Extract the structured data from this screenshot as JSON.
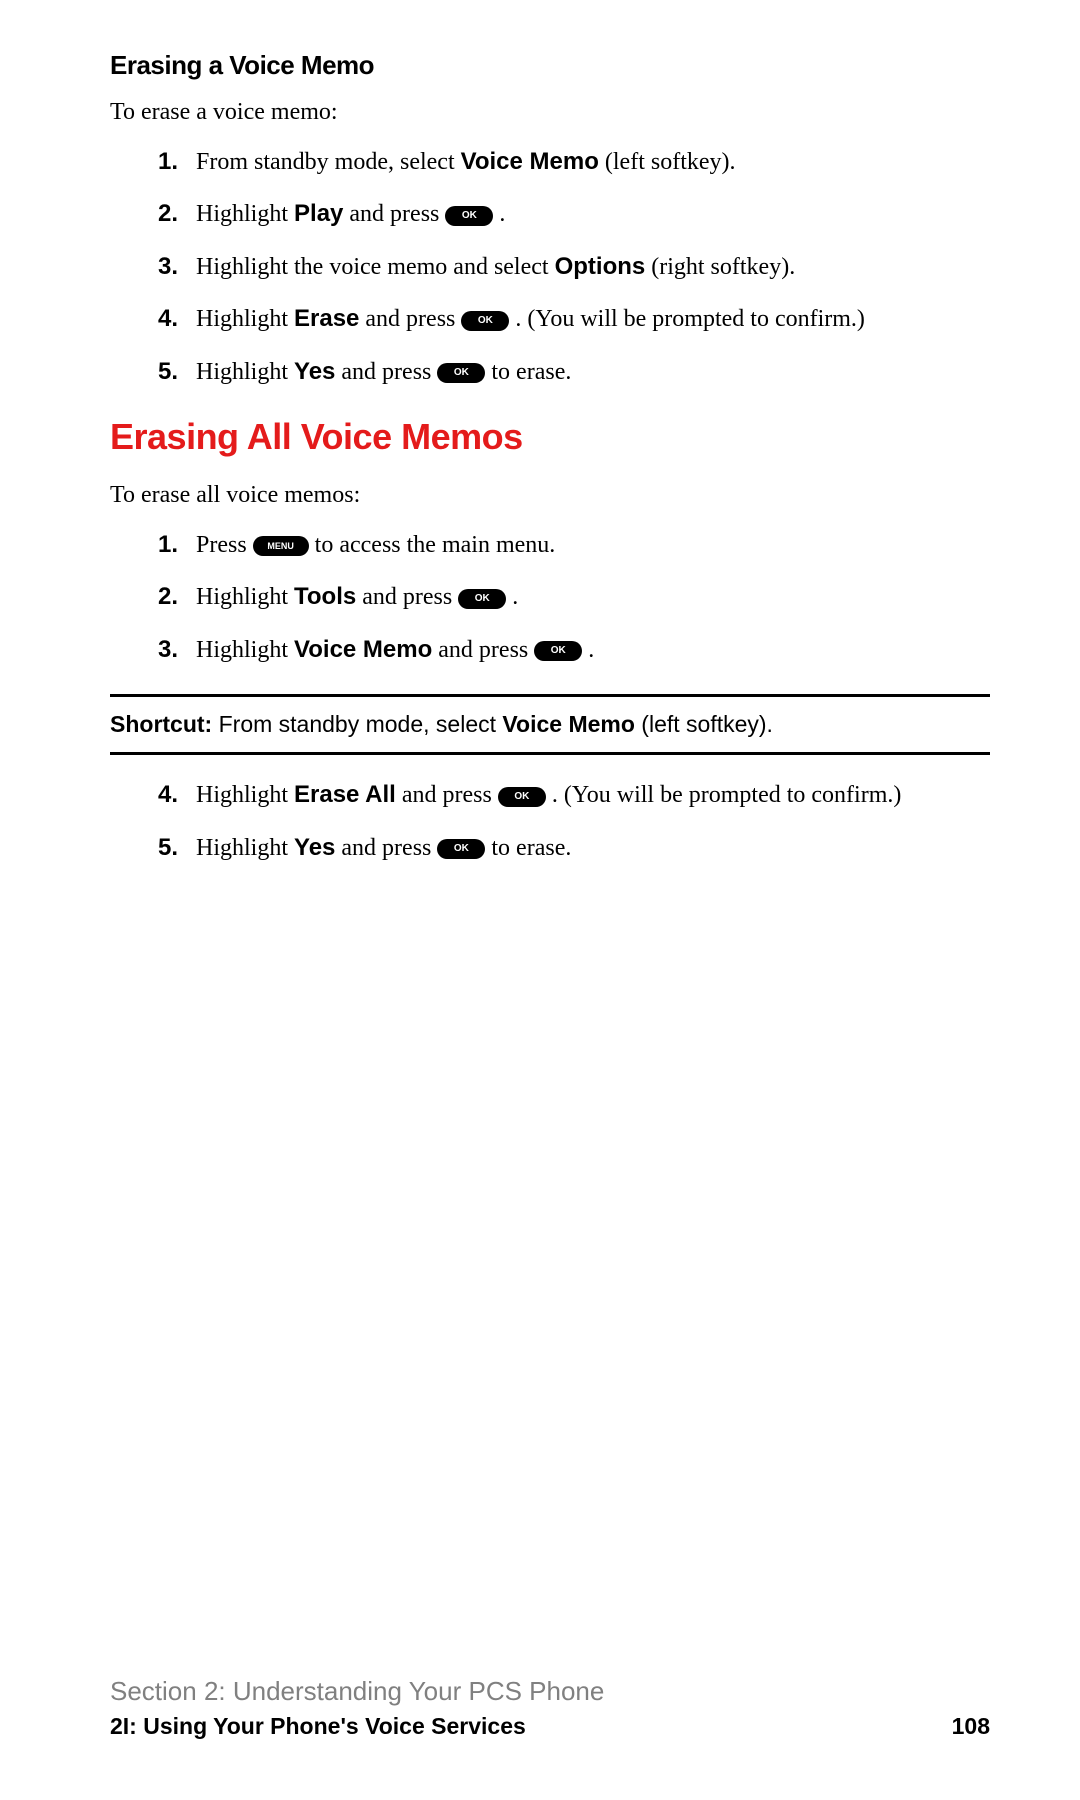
{
  "colors": {
    "accent": "#e41b1b"
  },
  "buttons": {
    "ok": "OK",
    "menu": "MENU"
  },
  "section1": {
    "heading": "Erasing a Voice Memo",
    "intro": "To erase a voice memo:",
    "steps": [
      {
        "n": "1.",
        "pre": "From standby mode, select ",
        "b1": "Voice Memo",
        "post": " (left softkey)."
      },
      {
        "n": "2.",
        "pre": "Highlight ",
        "b1": "Play",
        "mid": " and press ",
        "btn": "ok",
        "post": " ."
      },
      {
        "n": "3.",
        "pre": "Highlight the voice memo and select ",
        "b1": "Options",
        "post": " (right softkey)."
      },
      {
        "n": "4.",
        "pre": "Highlight ",
        "b1": "Erase",
        "mid": " and press ",
        "btn": "ok",
        "post": " . (You will be prompted to confirm.)"
      },
      {
        "n": "5.",
        "pre": "Highlight ",
        "b1": "Yes",
        "mid": " and press ",
        "btn": "ok",
        "post": " to erase."
      }
    ]
  },
  "section2": {
    "heading": "Erasing All Voice Memos",
    "intro": "To erase all voice memos:",
    "stepsA": [
      {
        "n": "1.",
        "pre": "Press ",
        "btn": "menu",
        "post": " to access the main menu."
      },
      {
        "n": "2.",
        "pre": "Highlight ",
        "b1": "Tools",
        "mid": " and press ",
        "btn": "ok",
        "post": " ."
      },
      {
        "n": "3.",
        "pre": "Highlight ",
        "b1": "Voice Memo",
        "mid": " and press ",
        "btn": "ok",
        "post": " ."
      }
    ],
    "shortcut": {
      "label": "Shortcut:",
      "pre": " From standby mode, select ",
      "b1": "Voice Memo",
      "post": " (left softkey)."
    },
    "stepsB": [
      {
        "n": "4.",
        "pre": "Highlight ",
        "b1": "Erase All",
        "mid": " and press ",
        "btn": "ok",
        "post": " . (You will be prompted to confirm.)"
      },
      {
        "n": "5.",
        "pre": "Highlight ",
        "b1": "Yes",
        "mid": " and press ",
        "btn": "ok",
        "post": " to erase."
      }
    ]
  },
  "footer": {
    "section": "Section 2: Understanding Your PCS Phone",
    "chapter": "2I: Using Your Phone's Voice Services",
    "page": "108"
  }
}
